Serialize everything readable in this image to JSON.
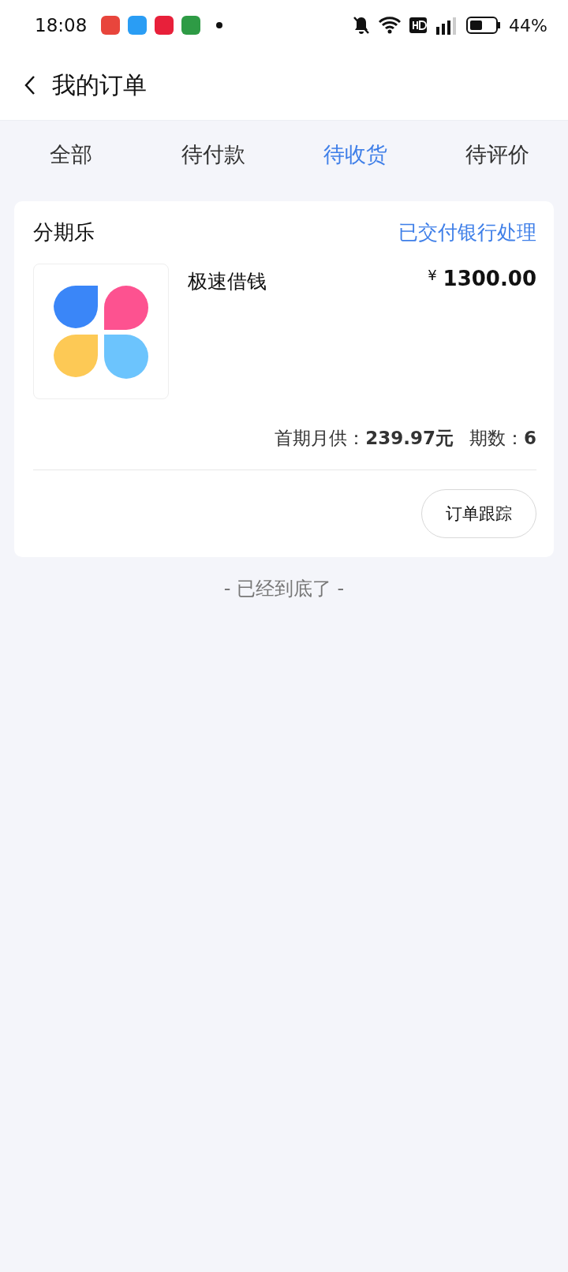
{
  "status_bar": {
    "time": "18:08",
    "battery": "44%"
  },
  "header": {
    "title": "我的订单"
  },
  "tabs": [
    {
      "label": "全部",
      "selected": false
    },
    {
      "label": "待付款",
      "selected": false
    },
    {
      "label": "待收货",
      "selected": true
    },
    {
      "label": "待评价",
      "selected": false
    }
  ],
  "orders": [
    {
      "store": "分期乐",
      "status": "已交付银行处理",
      "product": "极速借钱",
      "currency": "¥",
      "price": "1300.00",
      "summary": [
        "首期月供：**239.97元**",
        "期数：**6**"
      ],
      "action": "订单跟踪"
    }
  ],
  "end_note": "- 已经到底了 -"
}
